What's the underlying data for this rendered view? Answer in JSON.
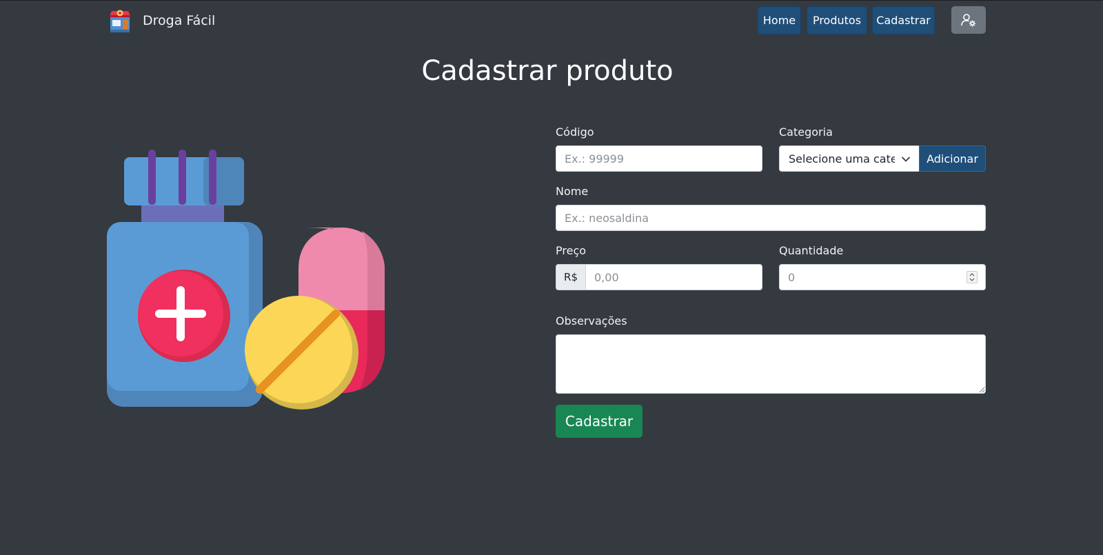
{
  "app": {
    "brand_name": "Droga Fácil"
  },
  "nav": {
    "home": "Home",
    "produtos": "Produtos",
    "cadastrar": "Cadastrar",
    "user_icon": "user-gear-icon"
  },
  "page": {
    "title": "Cadastrar produto"
  },
  "form": {
    "codigo": {
      "label": "Código",
      "placeholder": "Ex.: 99999",
      "value": ""
    },
    "categoria": {
      "label": "Categoria",
      "selected": "Selecione uma categoria",
      "add_button": "Adicionar"
    },
    "nome": {
      "label": "Nome",
      "placeholder": "Ex.: neosaldina",
      "value": ""
    },
    "preco": {
      "label": "Preço",
      "prefix": "R$",
      "placeholder": "0,00",
      "value": ""
    },
    "quantidade": {
      "label": "Quantidade",
      "placeholder": "0",
      "value": ""
    },
    "observacoes": {
      "label": "Observações",
      "value": ""
    },
    "submit": "Cadastrar"
  },
  "colors": {
    "background": "#343a40",
    "primary": "#1f4e79",
    "success": "#198754",
    "secondary": "#6c757d"
  },
  "illustration": {
    "icons": [
      "medicine-bottle-icon",
      "capsule-icon",
      "pill-icon"
    ]
  }
}
